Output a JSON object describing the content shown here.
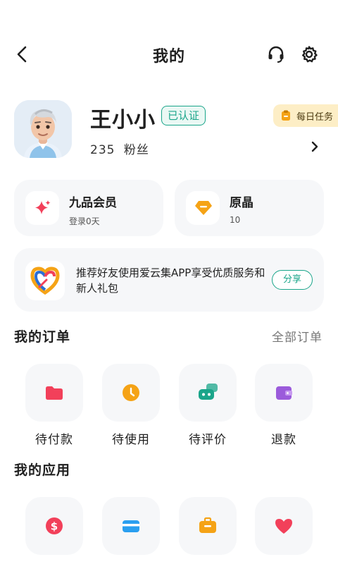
{
  "header": {
    "title": "我的",
    "icons": [
      "back-arrow-icon",
      "headset-icon",
      "settings-gear-icon"
    ]
  },
  "profile": {
    "name": "王小小",
    "verified_badge": "已认证",
    "fans_count": "235",
    "fans_label": "粉丝",
    "daily_task_label": "每日任务"
  },
  "membership": {
    "title": "九品会员",
    "subtitle": "登录0天",
    "icon": "sparkle-icon"
  },
  "crystal": {
    "title": "原晶",
    "value": "10",
    "icon": "gem-icon"
  },
  "referral": {
    "text": "推荐好友使用爱云集APP享受优质服务和新人礼包",
    "share_label": "分享",
    "icon": "heart-logo-icon"
  },
  "orders": {
    "section_title": "我的订单",
    "all_label": "全部订单",
    "items": [
      {
        "label": "待付款",
        "icon": "folder-icon",
        "color": "#f2405a"
      },
      {
        "label": "待使用",
        "icon": "clock-icon",
        "color": "#f5a316"
      },
      {
        "label": "待评价",
        "icon": "chat-icon",
        "color": "#1aa58a"
      },
      {
        "label": "退款",
        "icon": "wallet-icon",
        "color": "#9b5bdb"
      }
    ]
  },
  "apps": {
    "section_title": "我的应用",
    "items": [
      {
        "icon": "dollar-icon",
        "color": "#f2405a"
      },
      {
        "icon": "card-icon",
        "color": "#2a9ff0"
      },
      {
        "icon": "briefcase-icon",
        "color": "#f5a316"
      },
      {
        "icon": "heart-icon",
        "color": "#f2405a"
      }
    ]
  },
  "colors": {
    "accent": "#1aa58a",
    "card_bg": "#f6f7f9",
    "daily_task_bg": "#fdeec6"
  }
}
